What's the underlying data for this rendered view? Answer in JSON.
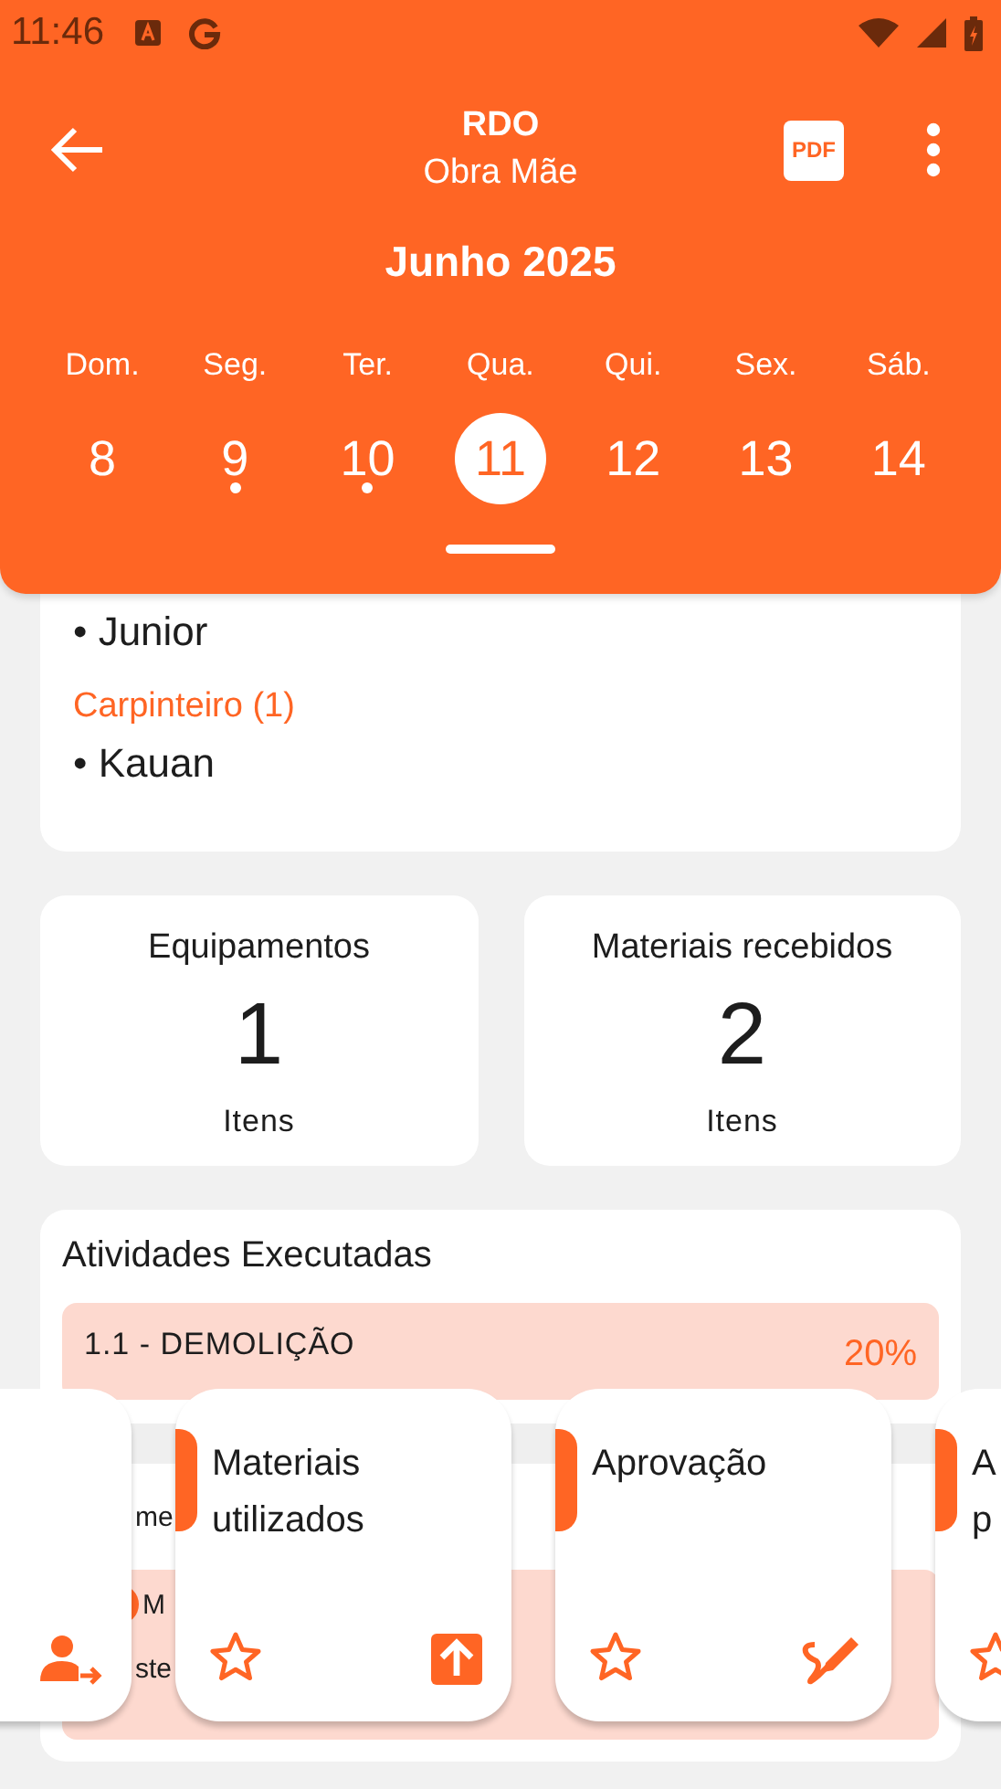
{
  "status_bar": {
    "time": "11:46"
  },
  "header": {
    "title": "RDO",
    "subtitle": "Obra Mãe",
    "pdf_label": "PDF",
    "month": "Junho 2025"
  },
  "week": [
    {
      "weekday": "Dom.",
      "day": "8",
      "selected": false,
      "has_entry": false
    },
    {
      "weekday": "Seg.",
      "day": "9",
      "selected": false,
      "has_entry": true
    },
    {
      "weekday": "Ter.",
      "day": "10",
      "selected": false,
      "has_entry": true
    },
    {
      "weekday": "Qua.",
      "day": "11",
      "selected": true,
      "has_entry": false
    },
    {
      "weekday": "Qui.",
      "day": "12",
      "selected": false,
      "has_entry": false
    },
    {
      "weekday": "Sex.",
      "day": "13",
      "selected": false,
      "has_entry": false
    },
    {
      "weekday": "Sáb.",
      "day": "14",
      "selected": false,
      "has_entry": false
    }
  ],
  "workforce": {
    "groups": [
      {
        "members": [
          "• Junior"
        ]
      },
      {
        "role": "Carpinteiro (1)",
        "members": [
          "• Kauan"
        ]
      }
    ]
  },
  "stats": [
    {
      "title": "Equipamentos",
      "value": "1",
      "unit": "Itens"
    },
    {
      "title": "Materiais recebidos",
      "value": "2",
      "unit": "Itens"
    }
  ],
  "activities": {
    "title": "Atividades Executadas",
    "item": {
      "name": "1.1 - DEMOLIÇÃO",
      "percent": "20%"
    },
    "fragments": {
      "row": "me",
      "note_start": "M",
      "note_text": "ste"
    }
  },
  "shortcuts": [
    {
      "kind": "assign-user"
    },
    {
      "title_lines": [
        "Materiais",
        "utilizados"
      ],
      "kind": "upload"
    },
    {
      "title_lines": [
        "Aprovação"
      ],
      "kind": "sign"
    },
    {
      "title_lines": [
        "A",
        "p"
      ],
      "kind": "none"
    }
  ]
}
